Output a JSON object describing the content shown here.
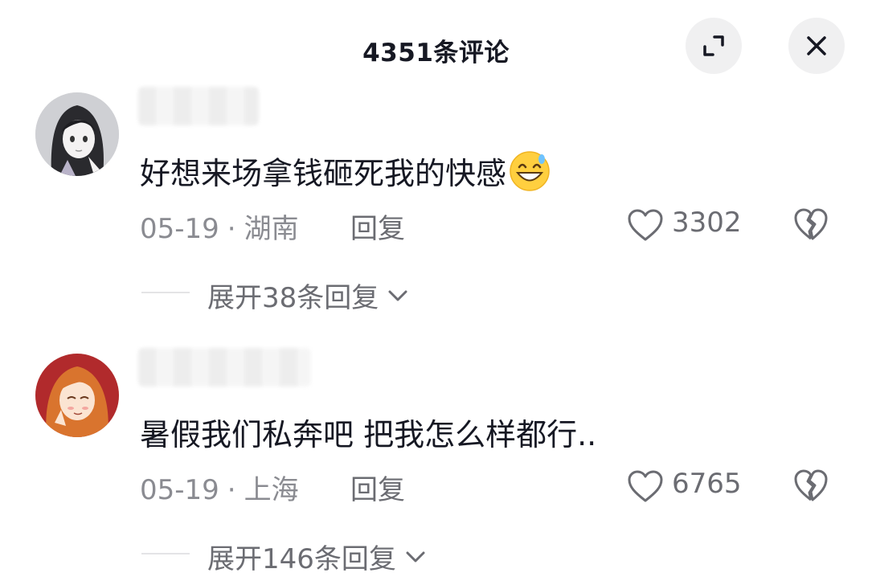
{
  "header": {
    "title": "4351条评论"
  },
  "comments": [
    {
      "text": "好想来场拿钱砸死我的快感",
      "emoji": "grinning-sweat-emoji",
      "date": "05-19",
      "separator": "·",
      "location": "湖南",
      "reply_label": "回复",
      "likes": "3302",
      "expand_label": "展开38条回复"
    },
    {
      "text": "暑假我们私奔吧 把我怎么样都行..",
      "date": "05-19",
      "separator": "·",
      "location": "上海",
      "reply_label": "回复",
      "likes": "6765",
      "expand_label": "展开146条回复"
    }
  ],
  "colors": {
    "text_primary": "#161823",
    "text_secondary": "#8a8b91",
    "icon_bg": "#f0f0f1"
  }
}
